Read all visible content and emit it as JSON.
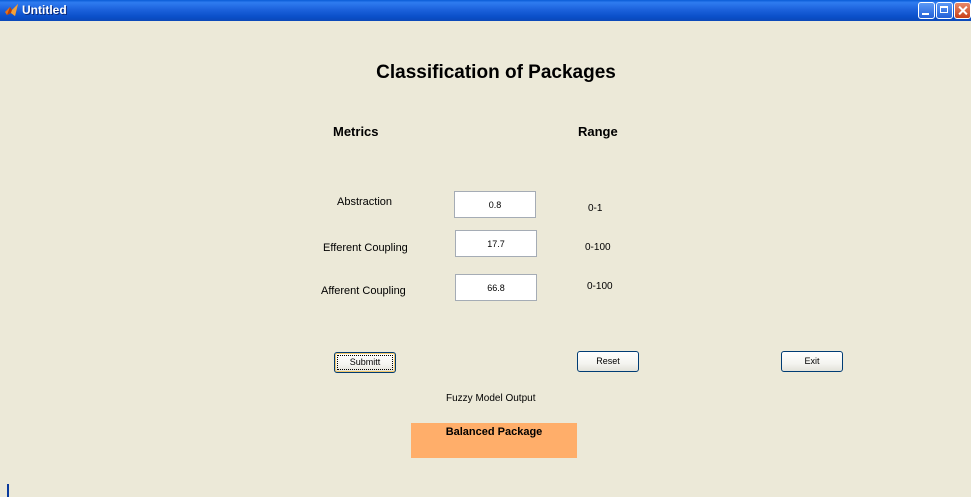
{
  "window": {
    "title": "Untitled",
    "icon": "matlab-icon",
    "controls": [
      "minimize-icon",
      "maximize-icon",
      "close-icon"
    ]
  },
  "main": {
    "heading": "Classification of Packages",
    "metrics_header": "Metrics",
    "range_header": "Range",
    "rows": [
      {
        "label": "Abstraction",
        "value": "0.8",
        "range": "0-1"
      },
      {
        "label": "Efferent Coupling",
        "value": "17.7",
        "range": "0-100"
      },
      {
        "label": "Afferent Coupling",
        "value": "66.8",
        "range": "0-100"
      }
    ],
    "buttons": {
      "submit": "Submitt",
      "reset": "Reset",
      "exit": "Exit"
    },
    "output_label": "Fuzzy Model Output",
    "output_value": "Balanced Package"
  },
  "colors": {
    "background": "#ece9d8",
    "titlebar": "#0a4fc9",
    "output_box": "#ffae6a"
  }
}
